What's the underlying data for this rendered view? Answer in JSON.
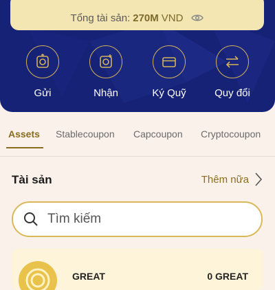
{
  "colors": {
    "header_bg": "#162276",
    "accent_gold": "#d4b25a",
    "page_bg": "#faf1ea",
    "active_tab": "#8a6d1c"
  },
  "balance": {
    "label": "Tổng tài sản:",
    "amount": "270M",
    "currency": "VND",
    "icon": "eye-icon"
  },
  "actions": [
    {
      "label": "Gửi",
      "icon": "send-icon"
    },
    {
      "label": "Nhận",
      "icon": "receive-icon"
    },
    {
      "label": "Ký Quỹ",
      "icon": "card-icon"
    },
    {
      "label": "Quy đổi",
      "icon": "exchange-icon"
    }
  ],
  "tabs": [
    {
      "label": "Assets",
      "active": true
    },
    {
      "label": "Stablecoupon",
      "active": false
    },
    {
      "label": "Capcoupon",
      "active": false
    },
    {
      "label": "Cryptocoupon",
      "active": false
    }
  ],
  "section": {
    "title": "Tài sản",
    "more_label": "Thêm nữa"
  },
  "search": {
    "placeholder": "Tìm kiếm",
    "value": ""
  },
  "asset_row": {
    "name": "GREAT",
    "quantity": "0 GREAT"
  }
}
